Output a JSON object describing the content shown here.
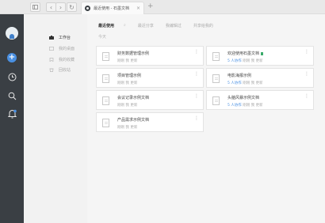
{
  "browser": {
    "tab_title": "最近使用 - 石墨文档",
    "tab_close": "×",
    "new_tab": "+",
    "back": "‹",
    "forward": "›",
    "reload": "↻"
  },
  "nav": {
    "items": [
      {
        "label": "工作台",
        "active": true
      },
      {
        "label": "我的桌面",
        "active": false
      },
      {
        "label": "我的收藏",
        "active": false
      },
      {
        "label": "回收站",
        "active": false
      }
    ]
  },
  "filters": {
    "recent": "最近使用",
    "shared": "最近分享",
    "edited": "我编辑过",
    "shared_with": "共享给我的"
  },
  "section": {
    "label": "今天"
  },
  "documents": [
    {
      "name": "财务数据管理示例",
      "meta": "刚刚 我 更新",
      "shared": ""
    },
    {
      "name": "欢迎使用石墨文档",
      "meta": "刚刚 我 更新",
      "shared": "5 人协作",
      "tag": true
    },
    {
      "name": "项目管理示例",
      "meta": "刚刚 我 更新",
      "shared": ""
    },
    {
      "name": "电影海报示例",
      "meta": "刚刚 我 更新",
      "shared": "5 人协作"
    },
    {
      "name": "会议记录示例文档",
      "meta": "刚刚 我 更新",
      "shared": ""
    },
    {
      "name": "头脑风暴示例文档",
      "meta": "刚刚 我 更新",
      "shared": "5 人协作"
    },
    {
      "name": "产品需求示例文档",
      "meta": "刚刚 我 更新",
      "shared": ""
    }
  ],
  "more_glyph": "⋮",
  "colors": {
    "rail": "#3a3f44",
    "accent": "#4a90e2"
  }
}
